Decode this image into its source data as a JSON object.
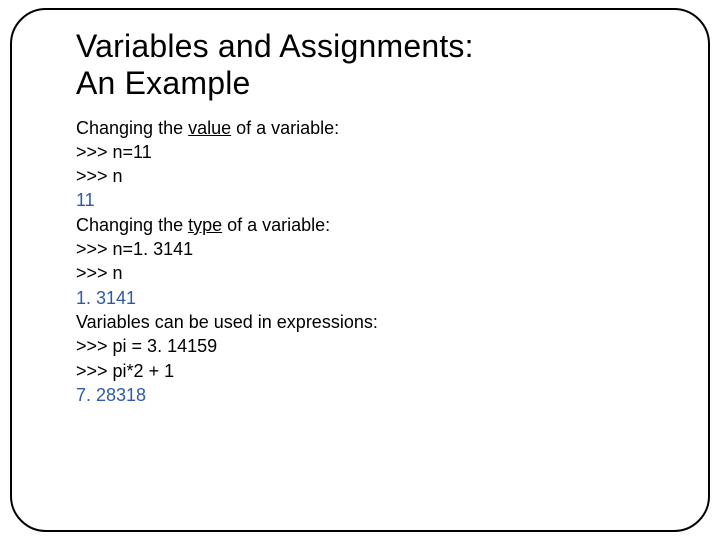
{
  "title_line1": "Variables and Assignments:",
  "title_line2": " An Example",
  "section1": {
    "intro_prefix": "Changing the ",
    "intro_underlined": "value",
    "intro_suffix": " of a variable:",
    "line1": ">>> n=11",
    "line2": ">>> n",
    "output": "11"
  },
  "section2": {
    "intro_prefix": "Changing the ",
    "intro_underlined": "type",
    "intro_suffix": " of a variable:",
    "line1": ">>> n=1. 3141",
    "line2": ">>> n",
    "output": "1. 3141"
  },
  "section3": {
    "intro": "Variables can be used in expressions:",
    "line1": ">>> pi = 3. 14159",
    "line2": ">>> pi*2 + 1",
    "output": "7. 28318"
  }
}
